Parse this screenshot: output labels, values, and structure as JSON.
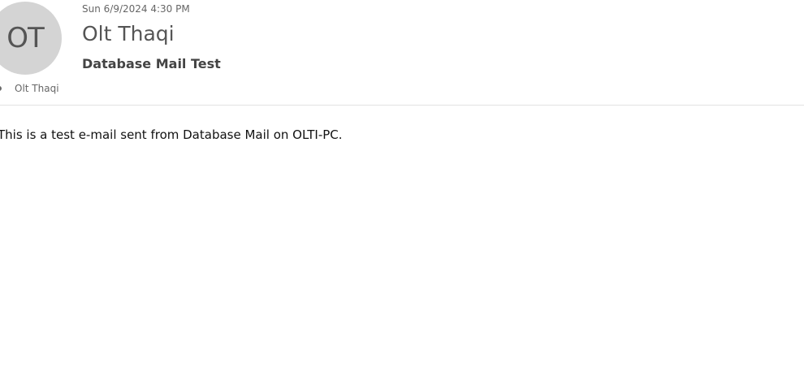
{
  "message": {
    "avatar_initials": "OT",
    "timestamp": "Sun 6/9/2024 4:30 PM",
    "sender_name": "Olt Thaqi",
    "subject": "Database Mail Test",
    "recipients": [
      {
        "name": "Olt Thaqi"
      }
    ],
    "body": "This is a test e-mail sent from Database Mail on OLTI-PC."
  },
  "colors": {
    "avatar_background": "#d4d4d4",
    "avatar_text": "#555555",
    "meta_text": "#666666",
    "divider": "#e3e3e3",
    "body_text": "#111111"
  }
}
